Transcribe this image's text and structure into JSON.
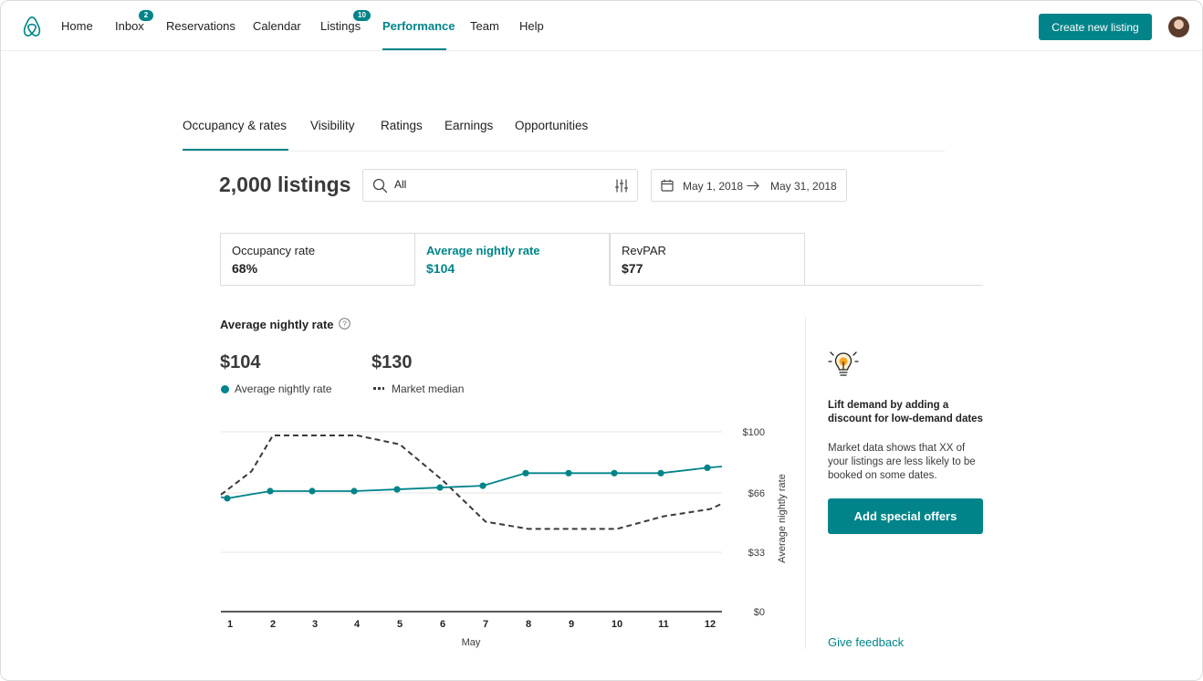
{
  "nav": {
    "items": [
      {
        "label": "Home"
      },
      {
        "label": "Inbox",
        "badge": "2"
      },
      {
        "label": "Reservations"
      },
      {
        "label": "Calendar"
      },
      {
        "label": "Listings",
        "badge": "10"
      },
      {
        "label": "Performance",
        "active": true
      },
      {
        "label": "Team"
      },
      {
        "label": "Help"
      }
    ],
    "create_button": "Create new listing",
    "accent_color": "#008489"
  },
  "tabs": [
    {
      "label": "Occupancy & rates",
      "active": true
    },
    {
      "label": "Visibility"
    },
    {
      "label": "Ratings"
    },
    {
      "label": "Earnings"
    },
    {
      "label": "Opportunities"
    }
  ],
  "filters": {
    "listings_count": "2,000 listings",
    "search_value": "All",
    "date_start": "May 1, 2018",
    "date_end": "May 31, 2018"
  },
  "metrics": [
    {
      "label": "Occupancy rate",
      "value": "68%"
    },
    {
      "label": "Average nightly rate",
      "value": "$104",
      "active": true
    },
    {
      "label": "RevPAR",
      "value": "$77"
    }
  ],
  "chart_header": {
    "title": "Average nightly rate",
    "primary_value": "$104",
    "primary_label": "Average nightly rate",
    "market_value": "$130",
    "market_label": "Market median"
  },
  "chart_data": {
    "type": "line",
    "x": [
      1,
      2,
      3,
      4,
      5,
      6,
      7,
      8,
      9,
      10,
      11,
      12
    ],
    "xlabel": "May",
    "ylabel": "Average nightly rate",
    "ylim": [
      0,
      100
    ],
    "y_ticks": [
      "$0",
      "$33",
      "$66",
      "$100"
    ],
    "grid": true,
    "series": [
      {
        "name": "Average nightly rate",
        "style": "solid-with-markers",
        "color": "#008489",
        "values": [
          63,
          67,
          67,
          67,
          68,
          69,
          70,
          77,
          77,
          77,
          77,
          80
        ]
      },
      {
        "name": "Market median",
        "style": "dashed",
        "color": "#3a3a3a",
        "values": [
          98,
          98,
          98,
          93,
          73,
          50,
          46,
          46,
          46,
          53,
          57,
          60
        ],
        "x": [
          2,
          3,
          4,
          5,
          6,
          7,
          8,
          9,
          10,
          11,
          12,
          12.3
        ]
      }
    ]
  },
  "tip": {
    "title": "Lift demand by adding a discount for low-demand dates",
    "body": "Market data shows that XX of your listings are less likely to be booked on some dates.",
    "button": "Add special offers",
    "feedback_link": "Give feedback"
  }
}
